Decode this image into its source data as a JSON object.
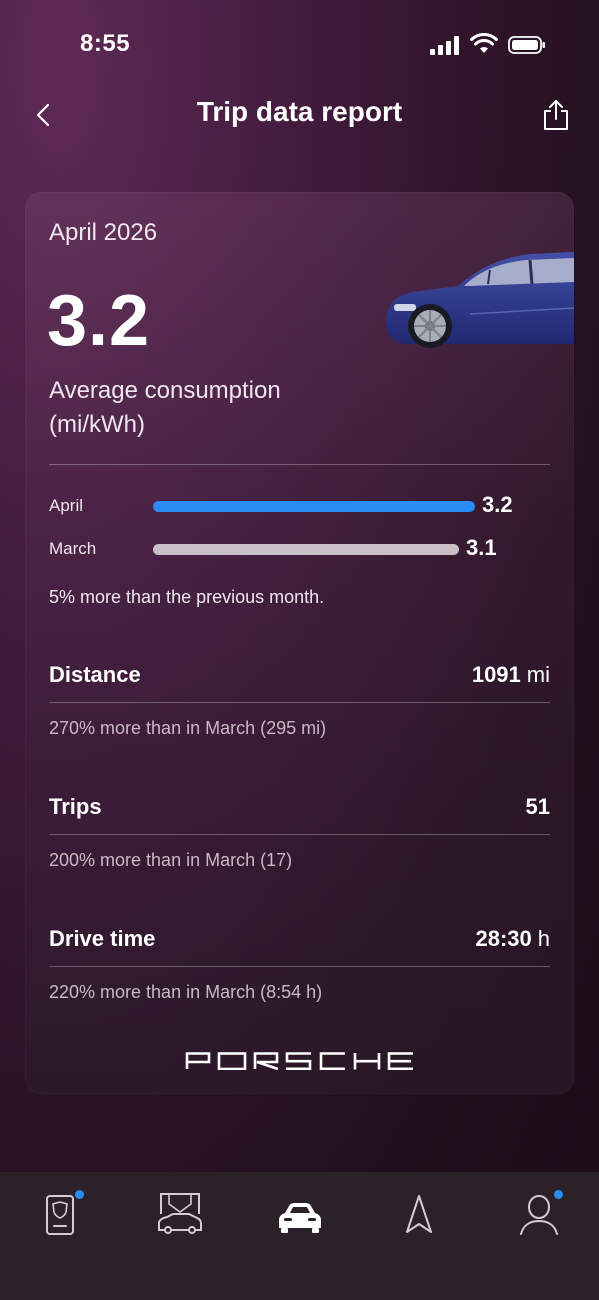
{
  "status_bar": {
    "time": "8:55"
  },
  "header": {
    "title": "Trip data report"
  },
  "report": {
    "month": "April 2026",
    "average_value": "3.2",
    "average_label": "Average consumption (mi/kWh)",
    "comparison_bars": [
      {
        "label": "April",
        "value": "3.2",
        "fraction": 1.0,
        "color": "#2b8cf5"
      },
      {
        "label": "March",
        "value": "3.1",
        "fraction": 0.95,
        "color": "#c8c0c6"
      }
    ],
    "comparison_text": "5% more than the previous month.",
    "stats": [
      {
        "label": "Distance",
        "value": "1091",
        "unit": "mi",
        "sub": "270% more than in March (295 mi)"
      },
      {
        "label": "Trips",
        "value": "51",
        "unit": "",
        "sub": "200% more than in March (17)"
      },
      {
        "label": "Drive time",
        "value": "28:30",
        "unit": "h",
        "sub": "220% more than in March (8:54 h)"
      }
    ],
    "brand": "PORSCHE"
  },
  "bottom_nav": {
    "items": [
      {
        "icon": "vehicle-card-icon",
        "badge": true
      },
      {
        "icon": "car-service-icon",
        "badge": false
      },
      {
        "icon": "car-icon",
        "badge": false,
        "active": true
      },
      {
        "icon": "navigation-arrow-icon",
        "badge": false
      },
      {
        "icon": "profile-icon",
        "badge": true
      }
    ]
  },
  "colors": {
    "accent": "#2b8cf5",
    "background": "#3f1a3b"
  }
}
